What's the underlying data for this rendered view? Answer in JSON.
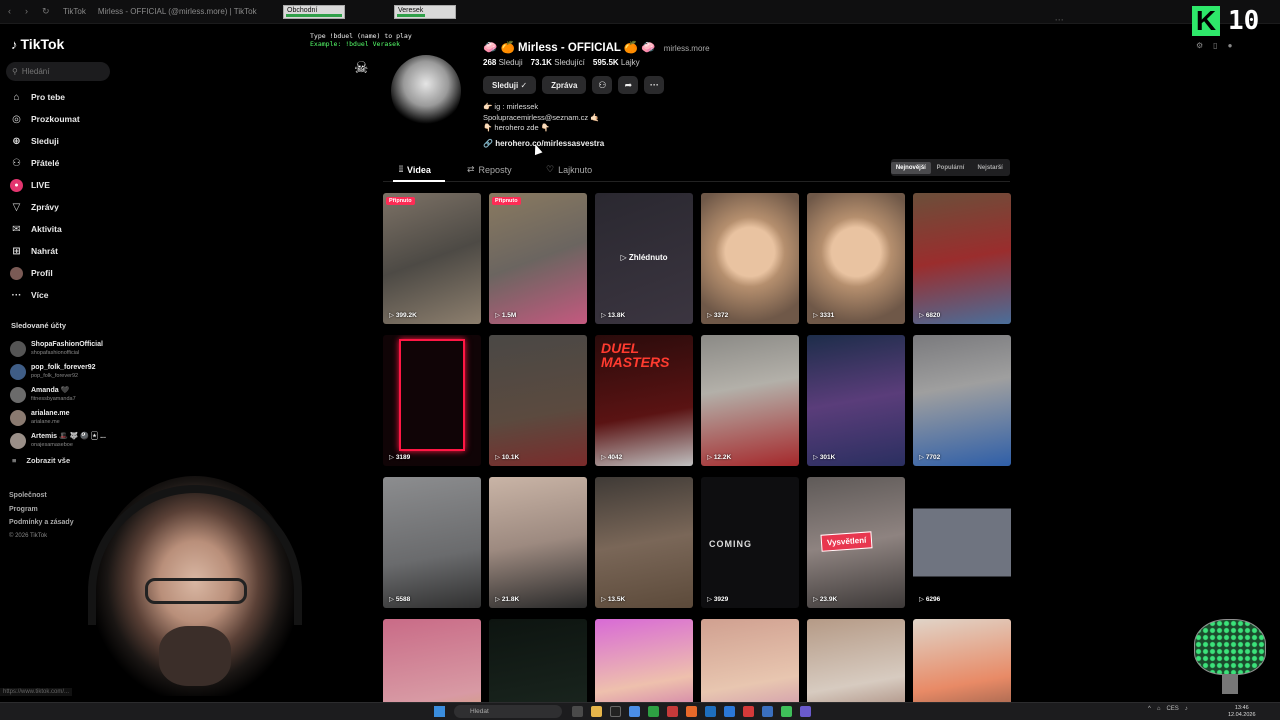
{
  "browser": {
    "tab1": "TikTok",
    "tab2": "Mirless - OFFICIAL (@mirless.more) | TikTok",
    "chip1": "Obchodní",
    "chip2": "Veresek"
  },
  "sidebar": {
    "brand": "TikTok",
    "search_placeholder": "Hledání",
    "items": [
      {
        "label": "Pro tebe",
        "icon": "home-icon"
      },
      {
        "label": "Prozkoumat",
        "icon": "compass-icon"
      },
      {
        "label": "Sleduji",
        "icon": "following-icon"
      },
      {
        "label": "Přátelé",
        "icon": "friends-icon"
      },
      {
        "label": "LIVE",
        "icon": "live-icon"
      },
      {
        "label": "Zprávy",
        "icon": "messages-icon"
      },
      {
        "label": "Aktivita",
        "icon": "activity-icon"
      },
      {
        "label": "Nahrát",
        "icon": "upload-icon"
      },
      {
        "label": "Profil",
        "icon": "profile-icon"
      },
      {
        "label": "Více",
        "icon": "more-icon"
      }
    ],
    "following_title": "Sledované účty",
    "following": [
      {
        "name": "ShopaFashionOfficial",
        "handle": "shopafashionofficial"
      },
      {
        "name": "pop_folk_forever92",
        "handle": "pop_folk_forever92"
      },
      {
        "name": "Amanda 🖤",
        "handle": "fitnessbyamanda7"
      },
      {
        "name": "arialane.me",
        "handle": "arialane.me"
      },
      {
        "name": "Artemis 🎩 🐺 🎱 🃏 ...",
        "handle": "onajesamaseboe"
      }
    ],
    "show_all": "Zobrazit vše",
    "footer": {
      "company": "Společnost",
      "program": "Program",
      "terms": "Podmínky a zásady",
      "copyright": "© 2026 TikTok"
    }
  },
  "stream": {
    "line1": "Type !bduel (name) to play",
    "line2": "Example: !bduel Verasek",
    "k_label": "K",
    "k_number": "10"
  },
  "profile": {
    "name": "🧼 🍊 Mirless - OFFICIAL 🍊 🧼",
    "handle": "mirless.more",
    "following_count": "268",
    "following_label": "Sleduji",
    "followers_count": "73.1K",
    "followers_label": "Sledující",
    "likes_count": "595.5K",
    "likes_label": "Lajky",
    "follow_btn": "Sleduji ✓",
    "message_btn": "Zpráva",
    "bio": [
      "👉🏻 ig : mirlessek",
      "Spolupracemirless@seznam.cz 🤙🏻",
      "👇🏻 herohero zde 👇🏻"
    ],
    "link": "herohero.co/mirlessasvestra"
  },
  "tabs": {
    "videos": "Videa",
    "reposts": "Reposty",
    "liked": "Lajknuto"
  },
  "sort": {
    "newest": "Nejnovější",
    "popular": "Populární",
    "oldest": "Nejstarší"
  },
  "videos": [
    {
      "views": "399.2K",
      "pinned": "Připnuto",
      "bg": "linear-gradient(160deg,#7d7266,#4d4a45 50%,#8d7f6e)"
    },
    {
      "views": "1.5M",
      "pinned": "Připnuto",
      "bg": "linear-gradient(160deg,#8a7a60,#6b6560 50%,#c4597f)"
    },
    {
      "views": "13.8K",
      "watched": "Zhlédnuto",
      "bg": "linear-gradient(160deg,#2a2830,#3b3540)"
    },
    {
      "views": "3372",
      "bg": "radial-gradient(circle at 50% 45%,#e9c3a1 0 28%,#b58f6e 40%,#6f5848 80%)"
    },
    {
      "views": "3331",
      "bg": "radial-gradient(circle at 50% 45%,#e9c3a1 0 28%,#b58f6e 40%,#6f5848 80%)"
    },
    {
      "views": "6820",
      "bg": "linear-gradient(170deg,#6b4f3a,#9a2d2d 50%,#4a6e9a)"
    },
    {
      "views": "3189",
      "bg": "#100406",
      "textbox": "true"
    },
    {
      "views": "10.1K",
      "bg": "linear-gradient(170deg,#4a4845,#5b4a3f 60%,#7b2b2b)"
    },
    {
      "views": "4042",
      "bg": "linear-gradient(170deg,#2a0b0b,#5a1313 60%,#c0c0c0)",
      "dm": "DUEL MASTERS"
    },
    {
      "views": "12.2K",
      "bg": "linear-gradient(170deg,#8b8a86,#b3b0a9 40%,#a5282b)"
    },
    {
      "views": "301K",
      "bg": "linear-gradient(170deg,#1d2d4a,#5a3d7a 50%,#2a2f60)"
    },
    {
      "views": "7702",
      "bg": "linear-gradient(170deg,#7a7a7d,#9f9f9f 40%,#2f5fa8)"
    },
    {
      "views": "5588",
      "bg": "linear-gradient(170deg,#8c8d8f,#6a6b6d 60%,#303030)"
    },
    {
      "views": "21.8K",
      "bg": "linear-gradient(170deg,#c9b4a6,#9d8a80 50%,#2a2a2a)"
    },
    {
      "views": "13.5K",
      "bg": "linear-gradient(170deg,#3f3a36,#7a6758 50%,#5c4a3a)"
    },
    {
      "views": "3929",
      "bg": "#0e0e10",
      "coming": "COMING"
    },
    {
      "views": "23.9K",
      "bg": "linear-gradient(170deg,#5f5a58,#8e8380 50%,#3d3938)",
      "label": "Vysvětlení"
    },
    {
      "views": "6296",
      "bg": "linear-gradient(180deg,#000 0 24%,#6f7480 24% 76%,#000 76%)"
    },
    {
      "views": "",
      "bg": "linear-gradient(170deg,#c96b87,#d89aa4 60%,#caa544)"
    },
    {
      "views": "",
      "bg": "linear-gradient(170deg,#0d1410,#1e2b23)"
    },
    {
      "views": "",
      "bg": "linear-gradient(170deg,#d86ad6,#eec0ad 50%,#b03aa5)"
    },
    {
      "views": "",
      "bg": "linear-gradient(170deg,#d0a090,#e8c6b0 50%,#b76ba7)"
    },
    {
      "views": "",
      "bg": "linear-gradient(170deg,#b59a86,#d7cbc0 50%,#7a4a3a)"
    },
    {
      "views": "",
      "bg": "linear-gradient(170deg,#e0d4c8,#e88a66 50%,#4e3a34)"
    }
  ],
  "taskbar": {
    "search": "Hledat",
    "tray": "CES",
    "time": "13:46",
    "date": "12.04.2026"
  },
  "hover_url": "https://www.tiktok.com/..."
}
